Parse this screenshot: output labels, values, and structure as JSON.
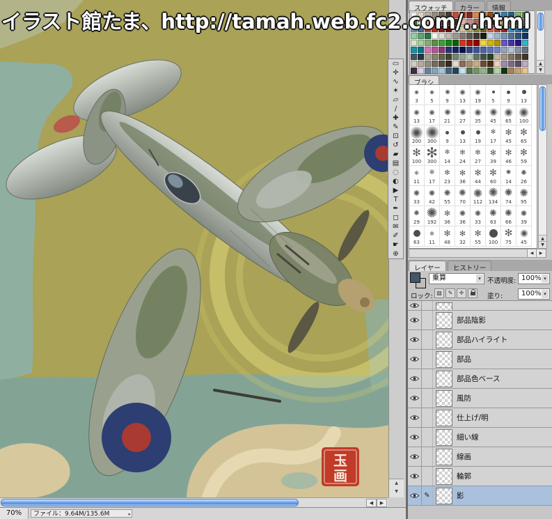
{
  "watermark": "イラスト館たま、http://tamah.web.fc2.com/..html",
  "canvas": {
    "background": "#a9a257",
    "water": "#8fb0a0",
    "sea": "#83a495",
    "land": "#d6c69c",
    "sand": "#e8dbb4",
    "glow": "#ecdf82",
    "roundel_blue": "#2c3e72",
    "roundel_red": "#a83a32",
    "seal_color": "#c23a28",
    "seal_char1": "玉",
    "seal_char2": "画"
  },
  "toolbar": {
    "tools": [
      {
        "name": "marquee-tool",
        "glyph": "▭"
      },
      {
        "name": "move-tool",
        "glyph": "✛"
      },
      {
        "name": "lasso-tool",
        "glyph": "∿"
      },
      {
        "name": "magic-wand-tool",
        "glyph": "✶"
      },
      {
        "name": "crop-tool",
        "glyph": "▱"
      },
      {
        "name": "slice-tool",
        "glyph": "∕"
      },
      {
        "name": "healing-brush-tool",
        "glyph": "✚"
      },
      {
        "name": "brush-tool",
        "glyph": "✎"
      },
      {
        "name": "clone-stamp-tool",
        "glyph": "⊡"
      },
      {
        "name": "history-brush-tool",
        "glyph": "↺"
      },
      {
        "name": "eraser-tool",
        "glyph": "▰"
      },
      {
        "name": "gradient-tool",
        "glyph": "▤"
      },
      {
        "name": "blur-tool",
        "glyph": "◌"
      },
      {
        "name": "dodge-tool",
        "glyph": "◐"
      },
      {
        "name": "path-select-tool",
        "glyph": "▶"
      },
      {
        "name": "type-tool",
        "glyph": "T"
      },
      {
        "name": "pen-tool",
        "glyph": "✒"
      },
      {
        "name": "shape-tool",
        "glyph": "◻"
      },
      {
        "name": "notes-tool",
        "glyph": "✉"
      },
      {
        "name": "eyedropper-tool",
        "glyph": "✐"
      },
      {
        "name": "hand-tool",
        "glyph": "☛"
      },
      {
        "name": "zoom-tool",
        "glyph": "⊕"
      }
    ]
  },
  "swatches": {
    "tabs": [
      "スウォッチ",
      "カラー",
      "情報"
    ],
    "active_tab": "スウォッチ",
    "rows": [
      [
        "#f2ede2",
        "#d8d2c2",
        "#b9b2a0",
        "#968e7a",
        "#6e6654",
        "#463e2e",
        "#c44a3a",
        "#a33527",
        "#7e291e",
        "#d28a4e",
        "#ad6a32",
        "#84501e",
        "#5a9ec4",
        "#3c7ea6",
        "#286084",
        "#8ab272",
        "#629254",
        "#40703a"
      ],
      [
        "#e6ddcc",
        "#c6baa4",
        "#a5947a",
        "#85745a",
        "#645438",
        "#44341c",
        "#ddb6ac",
        "#c28e84",
        "#a5685e",
        "#864a3e",
        "#663022",
        "#d5c48c",
        "#b5a464",
        "#95843c",
        "#756418",
        "#a6bed4",
        "#7a96b4",
        "#4c688c"
      ],
      [
        "#cc4636",
        "#ac3026",
        "#8a1c14",
        "#660c08",
        "#eee6d4",
        "#cec6a4",
        "#aea674",
        "#8e8644",
        "#6e6618",
        "#e26450",
        "#bc4430",
        "#942618",
        "#4694cc",
        "#2874ac",
        "#0c548c",
        "#94cca4",
        "#5ea474",
        "#2c744c"
      ],
      [
        "#f6f6ee",
        "#dedad2",
        "#bebab2",
        "#9e9a92",
        "#7e7a72",
        "#5e5a52",
        "#3e3a32",
        "#1e1a12",
        "#c4d6e6",
        "#9cb6ce",
        "#7494b2",
        "#4c7496",
        "#2c547c",
        "#103462",
        "#d4e6c4",
        "#acce9c",
        "#84ae74",
        "#5c8e4c"
      ],
      [
        "#34a434",
        "#148414",
        "#046404",
        "#d43424",
        "#ac1404",
        "#8c0400",
        "#f4d434",
        "#d4b414",
        "#b49400",
        "#6454c4",
        "#4434a4",
        "#241484",
        "#34b4c4",
        "#1494a4",
        "#047484",
        "#d474b4",
        "#b45494",
        "#8c3474"
      ],
      [
        "#243474",
        "#14245c",
        "#041444",
        "#2c4484",
        "#3c5494",
        "#4c64a4",
        "#5c74b4",
        "#6c84c4",
        "#94a4bc",
        "#b4c4d4",
        "#8494a4",
        "#647484",
        "#445464",
        "#243444",
        "#a4a48c",
        "#84846c",
        "#64644c",
        "#44442c"
      ],
      [
        "#748474",
        "#94a494",
        "#b4c4b4",
        "#647464",
        "#445444",
        "#244424",
        "#c4b4a4",
        "#a49484",
        "#847464",
        "#645444",
        "#443424",
        "#d4ccbc",
        "#b4ac9c",
        "#948c7c",
        "#746c5c",
        "#544c3c",
        "#342c1c",
        "#e4dccc"
      ],
      [
        "#8c6c54",
        "#ac8c6c",
        "#ccac84",
        "#6c4c34",
        "#4c2c14",
        "#ecd4b4",
        "#9c8ca4",
        "#7c6c84",
        "#5c4c64",
        "#bcacc4",
        "#3c2c44",
        "#dccce4",
        "#64849c",
        "#84a4bc",
        "#a4c4dc",
        "#44647c",
        "#24445c",
        "#c4e4f4"
      ],
      [
        "#54744c",
        "#74946c",
        "#94b48c",
        "#34542c",
        "#b4d4ac",
        "#14340c",
        "#a48454",
        "#c4a474",
        "#e4c494",
        "#846434",
        "#644414",
        "#f4e4c4",
        "#4c8c8c",
        "#6cacac",
        "#8ccccc",
        "#2c6c6c",
        "#0c4c4c",
        "#acecec"
      ]
    ]
  },
  "brushes": {
    "tab": "ブラシ",
    "items": [
      {
        "size": 3,
        "type": "soft"
      },
      {
        "size": 5,
        "type": "soft"
      },
      {
        "size": 9,
        "type": "soft"
      },
      {
        "size": 13,
        "type": "soft"
      },
      {
        "size": 19,
        "type": "soft"
      },
      {
        "size": 5,
        "type": "hard"
      },
      {
        "size": 9,
        "type": "hard"
      },
      {
        "size": 13,
        "type": "hard"
      },
      {
        "size": 13,
        "type": "soft"
      },
      {
        "size": 17,
        "type": "soft"
      },
      {
        "size": 21,
        "type": "soft"
      },
      {
        "size": 27,
        "type": "soft"
      },
      {
        "size": 35,
        "type": "soft"
      },
      {
        "size": 45,
        "type": "soft"
      },
      {
        "size": 65,
        "type": "soft"
      },
      {
        "size": 100,
        "type": "soft"
      },
      {
        "size": 200,
        "type": "soft"
      },
      {
        "size": 300,
        "type": "soft"
      },
      {
        "size": 9,
        "type": "hard"
      },
      {
        "size": 13,
        "type": "hard"
      },
      {
        "size": 19,
        "type": "hard"
      },
      {
        "size": 17,
        "type": "spatter"
      },
      {
        "size": 45,
        "type": "spatter"
      },
      {
        "size": 65,
        "type": "spatter"
      },
      {
        "size": 100,
        "type": "spatter"
      },
      {
        "size": 300,
        "type": "spatter"
      },
      {
        "size": 14,
        "type": "spatter"
      },
      {
        "size": 24,
        "type": "spatter"
      },
      {
        "size": 27,
        "type": "spatter"
      },
      {
        "size": 39,
        "type": "spatter"
      },
      {
        "size": 46,
        "type": "spatter"
      },
      {
        "size": 59,
        "type": "spatter"
      },
      {
        "size": 11,
        "type": "spatter"
      },
      {
        "size": 17,
        "type": "spatter"
      },
      {
        "size": 23,
        "type": "spatter"
      },
      {
        "size": 36,
        "type": "spatter"
      },
      {
        "size": 44,
        "type": "spatter"
      },
      {
        "size": 60,
        "type": "spatter"
      },
      {
        "size": 14,
        "type": "star"
      },
      {
        "size": 26,
        "type": "star"
      },
      {
        "size": 33,
        "type": "star"
      },
      {
        "size": 42,
        "type": "star"
      },
      {
        "size": 55,
        "type": "star"
      },
      {
        "size": 70,
        "type": "star"
      },
      {
        "size": 112,
        "type": "star"
      },
      {
        "size": 134,
        "type": "star"
      },
      {
        "size": 74,
        "type": "star"
      },
      {
        "size": 95,
        "type": "star"
      },
      {
        "size": 29,
        "type": "star"
      },
      {
        "size": 192,
        "type": "star"
      },
      {
        "size": 36,
        "type": "spatter"
      },
      {
        "size": 36,
        "type": "star"
      },
      {
        "size": 33,
        "type": "star"
      },
      {
        "size": 63,
        "type": "star"
      },
      {
        "size": 66,
        "type": "star"
      },
      {
        "size": 39,
        "type": "star"
      },
      {
        "size": 63,
        "type": "hard"
      },
      {
        "size": 11,
        "type": "spatter"
      },
      {
        "size": 48,
        "type": "spatter"
      },
      {
        "size": 32,
        "type": "spatter"
      },
      {
        "size": 55,
        "type": "spatter"
      },
      {
        "size": 100,
        "type": "hard"
      },
      {
        "size": 75,
        "type": "spatter"
      },
      {
        "size": 45,
        "type": "soft"
      }
    ]
  },
  "layers_panel": {
    "tabs": [
      "レイヤー",
      "ヒストリー"
    ],
    "active_tab": "レイヤー",
    "blend_mode": "乗算",
    "opacity_label": "不透明度:",
    "opacity_value": "100%",
    "lock_label": "ロック:",
    "fill_label": "塗り:",
    "fill_value": "100%",
    "layers": [
      {
        "name": "",
        "partial": true
      },
      {
        "name": "部品陰影"
      },
      {
        "name": "部品ハイライト"
      },
      {
        "name": "部品"
      },
      {
        "name": "部品色ベース"
      },
      {
        "name": "風防"
      },
      {
        "name": "仕上げ/明"
      },
      {
        "name": "細い線"
      },
      {
        "name": "線画"
      },
      {
        "name": "輪郭"
      },
      {
        "name": "影",
        "selected": true
      }
    ]
  },
  "status_bar": {
    "zoom": "70%",
    "file_info": "ファイル：9.64M/135.6M"
  }
}
